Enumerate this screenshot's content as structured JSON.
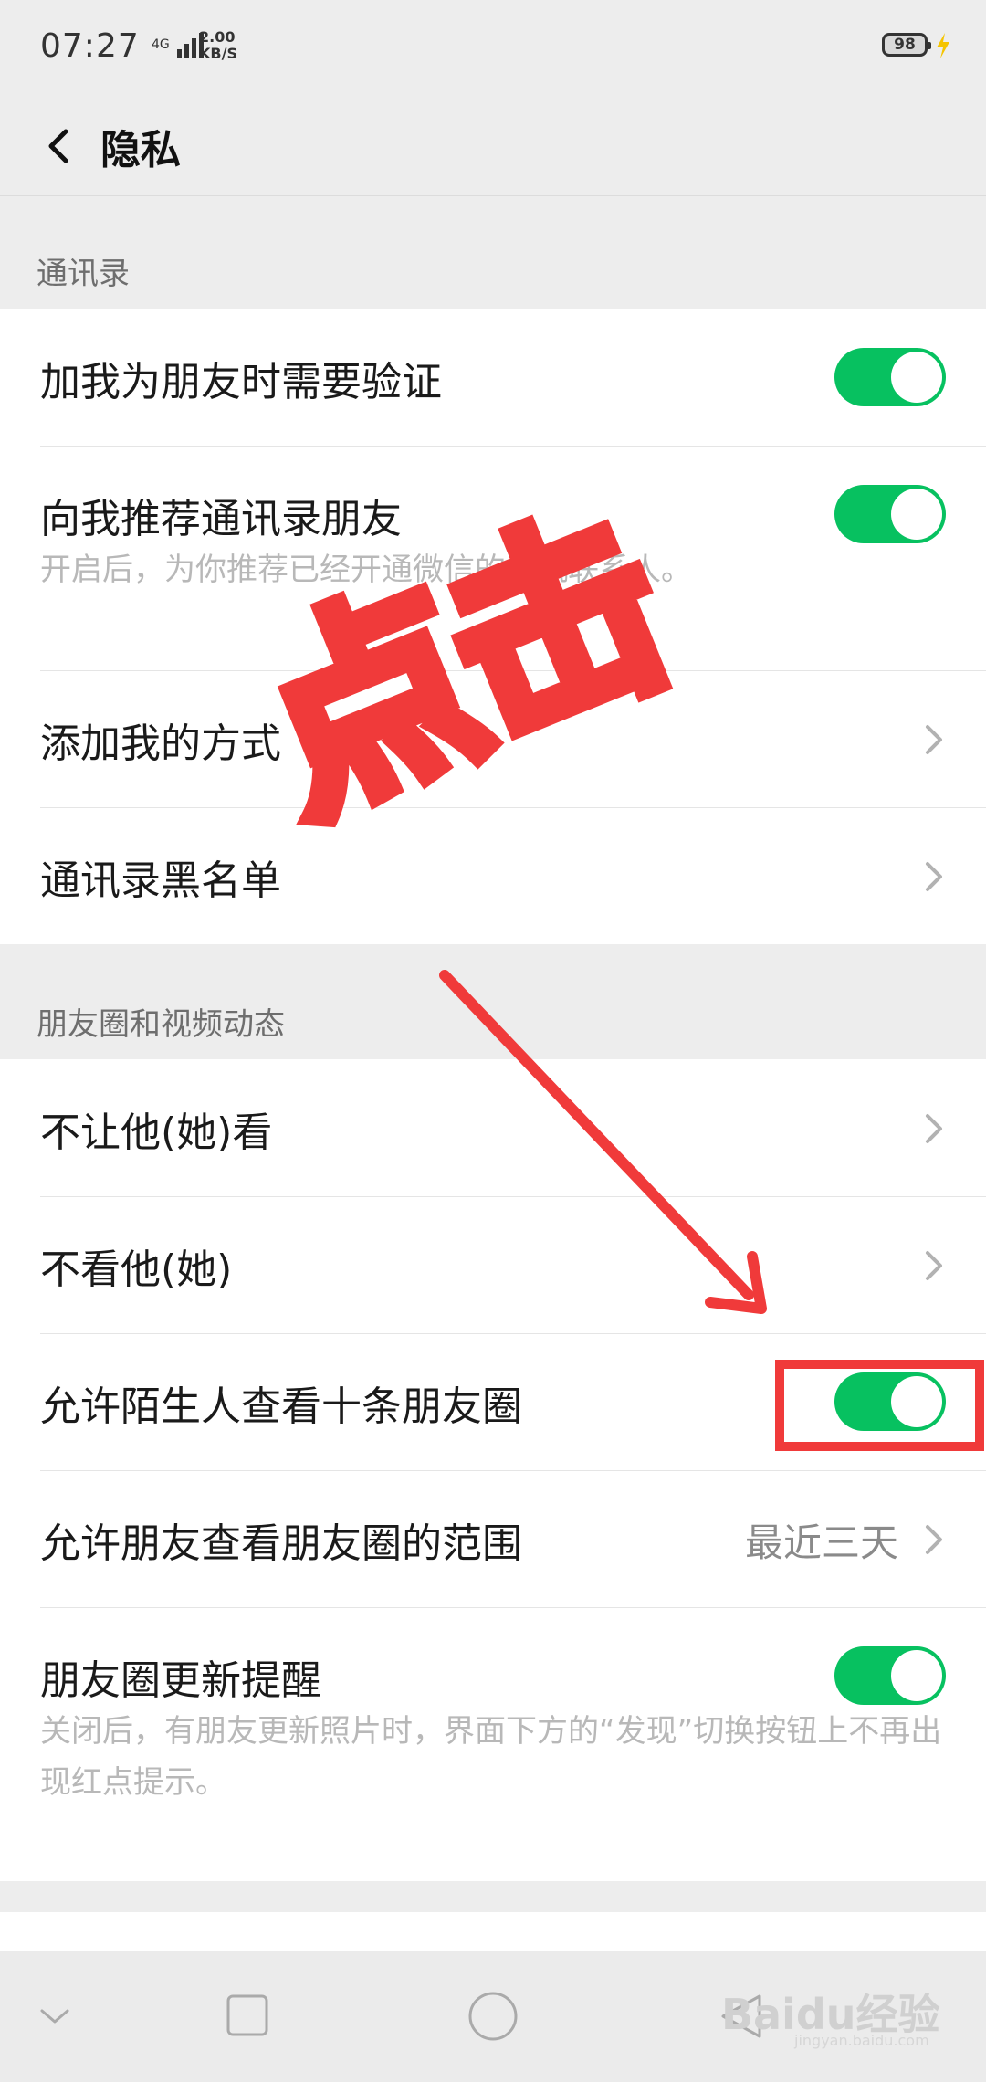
{
  "status_bar": {
    "time": "07:27",
    "network": "4G",
    "speed_value": "2.00",
    "speed_unit": "KB/S",
    "battery": "98"
  },
  "nav": {
    "title": "隐私"
  },
  "sections": {
    "contacts": {
      "header": "通讯录",
      "items": [
        {
          "label": "加我为朋友时需要验证",
          "control": "toggle",
          "on": true
        },
        {
          "label": "向我推荐通讯录朋友",
          "control": "toggle",
          "on": true,
          "desc": "开启后，为你推荐已经开通微信的手机联系人。"
        },
        {
          "label": "添加我的方式",
          "control": "chevron"
        },
        {
          "label": "通讯录黑名单",
          "control": "chevron"
        }
      ]
    },
    "moments": {
      "header": "朋友圈和视频动态",
      "items": [
        {
          "label": "不让他(她)看",
          "control": "chevron"
        },
        {
          "label": "不看他(她)",
          "control": "chevron"
        },
        {
          "label": "允许陌生人查看十条朋友圈",
          "control": "toggle",
          "on": true
        },
        {
          "label": "允许朋友查看朋友圈的范围",
          "control": "chevron",
          "value": "最近三天"
        },
        {
          "label": "朋友圈更新提醒",
          "control": "toggle",
          "on": true,
          "desc": "关闭后，有朋友更新照片时，界面下方的“发现”切换按钮上不再出现红点提示。"
        }
      ]
    }
  },
  "annotation": {
    "text": "点击",
    "color": "#f03a3a"
  },
  "watermark": {
    "text": "Baidu经验",
    "sub": "jingyan.baidu.com"
  },
  "colors": {
    "toggle_on": "#07c160",
    "background": "#ededed",
    "annotation": "#f03a3a"
  },
  "icons": [
    "back-arrow-icon",
    "chevron-right-icon",
    "nav-back-icon",
    "home-icon",
    "recents-icon",
    "charging-bolt-icon"
  ]
}
